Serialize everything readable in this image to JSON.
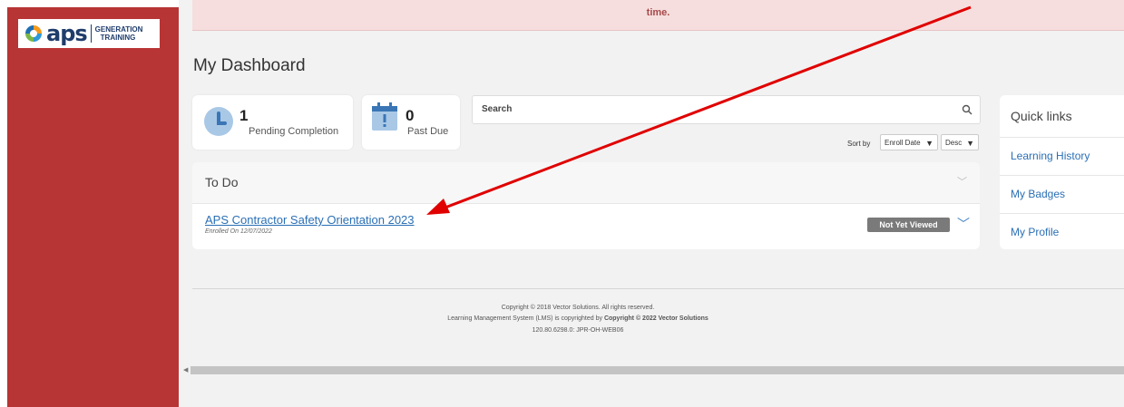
{
  "logo": {
    "brand": "aps",
    "line1": "GENERATION",
    "line2": "TRAINING"
  },
  "alert": {
    "text": "time."
  },
  "page_title": "My Dashboard",
  "stats": {
    "pending": {
      "count": "1",
      "label": "Pending Completion"
    },
    "past_due": {
      "count": "0",
      "label": "Past Due"
    }
  },
  "search": {
    "placeholder": "Search"
  },
  "sort": {
    "label": "Sort by",
    "field": "Enroll Date",
    "order": "Desc"
  },
  "todo": {
    "title": "To Do",
    "items": [
      {
        "title": "APS Contractor Safety Orientation 2023",
        "enrolled": "Enrolled On 12/07/2022",
        "status": "Not Yet Viewed"
      }
    ]
  },
  "quick_links": {
    "title": "Quick links",
    "items": [
      "Learning History",
      "My Badges",
      "My Profile"
    ]
  },
  "footer": {
    "line1": "Copyright © 2018 Vector Solutions. All rights reserved.",
    "line2_prefix": "Learning Management System (LMS) is copyrighted by",
    "line2_bold": "Copyright © 2022 Vector Solutions",
    "line3": "120.80.6298.0: JPR-OH-WEB06"
  },
  "colors": {
    "sidebar": "#b83535",
    "link": "#2a6fb5",
    "annotation_arrow": "#e00000"
  }
}
